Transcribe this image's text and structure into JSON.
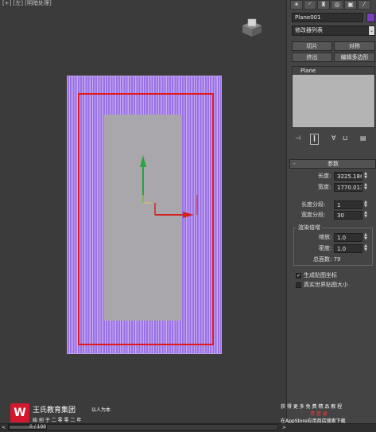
{
  "viewport": {
    "label": "[+] [左] [明暗处理]",
    "viewcube_icon": "viewcube-icon",
    "colors": {
      "background": "#3b3b3b",
      "plane_fill": "#9a70e4",
      "selection_box": "#e21a1a",
      "inner_rect": "#a9a7ab",
      "gizmo_y": "#2ca33e",
      "gizmo_x": "#d42020"
    }
  },
  "command_panel": {
    "tab_icons": [
      "sun-icon",
      "curve-icon",
      "hierarchy-icon",
      "motion-icon",
      "display-icon",
      "utilities-icon"
    ],
    "object_name": "Plane001",
    "object_color": "#7a3fc0",
    "modifier_list": "修改器列表",
    "buttons": {
      "slice": "切片",
      "symmetry": "对称",
      "extrude": "挤出",
      "edit_poly": "编辑多边形"
    },
    "stack_items": [
      "Plane"
    ],
    "toolbar_icons": [
      "pin-stack-icon",
      "show-end-result-icon",
      "make-unique-icon",
      "remove-modifier-icon",
      "configure-sets-icon"
    ],
    "rollout_title": "参数",
    "rollout_toggle": "-",
    "params": {
      "length_label": "长度:",
      "length_value": "3225.186",
      "width_label": "宽度:",
      "width_value": "1770.013",
      "length_segs_label": "长度分段:",
      "length_segs_value": "1",
      "width_segs_label": "宽度分段:",
      "width_segs_value": "30"
    },
    "render_group_title": "渲染倍增",
    "render": {
      "scale_label": "缩放:",
      "scale_value": "1.0",
      "density_label": "密度:",
      "density_value": "1.0",
      "total_faces": "总面数: 79"
    },
    "gen_map_coords": {
      "label": "生成贴图坐标",
      "checked": true
    },
    "real_world_map": {
      "label": "真实世界贴图大小",
      "checked": false
    },
    "spinner_up": "▲",
    "spinner_down": "▼"
  },
  "status": {
    "frame_counter": "0 / 100",
    "left_arrow": "<",
    "right_arrow": ">"
  },
  "watermark": {
    "logo_letter": "W",
    "brand": "王氏教育集团",
    "slogan": "以人为本",
    "founded": "始 创 于 二 零 零 二 年",
    "promo_line1": "获 得 更 多 免 费 精 品 教 程",
    "promo_line2": "请 登 录",
    "promo_line3": "在AppStore应用商店搜索下载"
  }
}
